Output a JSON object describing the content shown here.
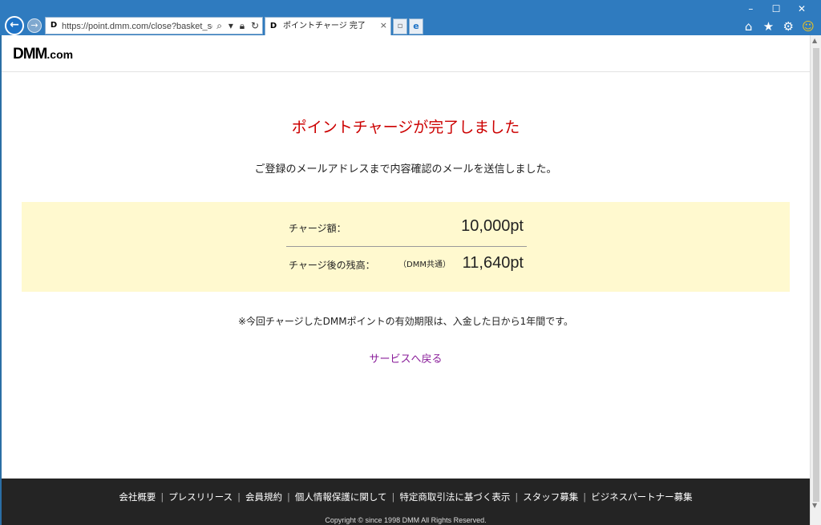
{
  "browser": {
    "url": "https://point.dmm.com/close?basket_serv",
    "tab_title": "ポイントチャージ 完了",
    "tab_favicon": "D",
    "address_favicon": "D",
    "window_controls": [
      "–",
      "☐",
      "✕"
    ],
    "toolbar_icons": [
      "home-icon",
      "star-icon",
      "gear-icon",
      "smiley-icon"
    ]
  },
  "site": {
    "logo_main": "DMM",
    "logo_suffix": ".com"
  },
  "main": {
    "heading": "ポイントチャージが完了しました",
    "notice": "ご登録のメールアドレスまで内容確認のメールを送信しました。",
    "charge_amount_label": "チャージ額：",
    "charge_amount_value": "10,000pt",
    "balance_label": "チャージ後の残高：",
    "balance_note": "（DMM共通）",
    "balance_value": "11,640pt",
    "expiry_note": "※今回チャージしたDMMポイントの有効期限は、入金した日から1年間です。",
    "back_link": "サービスへ戻る"
  },
  "footer": {
    "links": [
      "会社概要",
      "プレスリリース",
      "会員規約",
      "個人情報保護に関して",
      "特定商取引法に基づく表示",
      "スタッフ募集",
      "ビジネスパートナー募集"
    ],
    "copyright": "Copyright © since 1998 DMM All Rights Reserved."
  },
  "colors": {
    "heading": "#cc0000",
    "charge_box_bg": "#fff9cf",
    "link": "#8a1e9a",
    "footer_bg": "#242424",
    "chrome": "#2f7bbf"
  }
}
